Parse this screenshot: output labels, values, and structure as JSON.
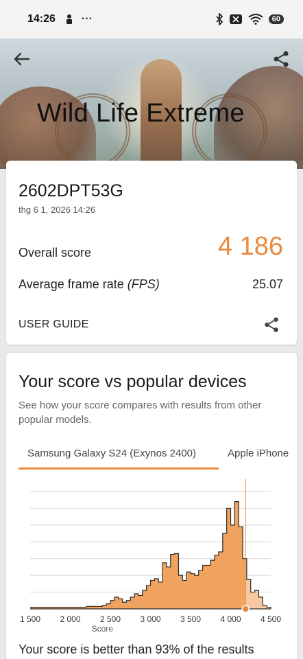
{
  "status_bar": {
    "time": "14:26",
    "battery": "60"
  },
  "hero": {
    "title": "Wild Life Extreme"
  },
  "result": {
    "device": "2602DPT53G",
    "date": "thg 6 1, 2026 14:26",
    "overall_label": "Overall score",
    "overall_value": "4 186",
    "fps_label": "Average frame rate",
    "fps_unit": "(FPS)",
    "fps_value": "25.07",
    "user_guide": "USER GUIDE"
  },
  "compare": {
    "title": "Your score vs popular devices",
    "subtitle": "See how your score compares with results from other popular models.",
    "tabs": [
      "Samsung Galaxy S24 (Exynos 2400)",
      "Apple iPhone"
    ],
    "summary": "Your score is better than 93% of the results"
  },
  "colors": {
    "accent": "#e98a3f",
    "fill": "#f0a35e",
    "fill_light": "#f7c9a0"
  },
  "chart_data": {
    "type": "area",
    "title": "",
    "xlabel": "Score",
    "ylabel": "",
    "xlim": [
      1500,
      4500
    ],
    "x_ticks": [
      "1 500",
      "2 000",
      "2 500",
      "3 000",
      "3 500",
      "4 000",
      "4 500"
    ],
    "your_score": 4186,
    "grid": true,
    "series": [
      {
        "x": [
          1500,
          1600,
          1700,
          1800,
          1900,
          2000,
          2100,
          2200,
          2300,
          2400,
          2450,
          2500,
          2550,
          2600,
          2650,
          2700,
          2750,
          2800,
          2850,
          2900,
          2950,
          3000,
          3050,
          3100,
          3150,
          3200,
          3250,
          3300,
          3350,
          3400,
          3450,
          3500,
          3550,
          3600,
          3650,
          3700,
          3750,
          3800,
          3850,
          3900,
          3950,
          4000,
          4050,
          4100,
          4150,
          4200,
          4250,
          4300,
          4350,
          4400,
          4450,
          4500
        ],
        "y": [
          2,
          2,
          2,
          2,
          2,
          2,
          2,
          3,
          3,
          4,
          6,
          10,
          14,
          12,
          8,
          10,
          14,
          18,
          16,
          22,
          28,
          34,
          36,
          32,
          55,
          50,
          65,
          66,
          40,
          34,
          44,
          42,
          40,
          46,
          52,
          52,
          58,
          64,
          68,
          90,
          120,
          100,
          128,
          98,
          60,
          35,
          20,
          22,
          14,
          4,
          2,
          0
        ]
      }
    ]
  }
}
